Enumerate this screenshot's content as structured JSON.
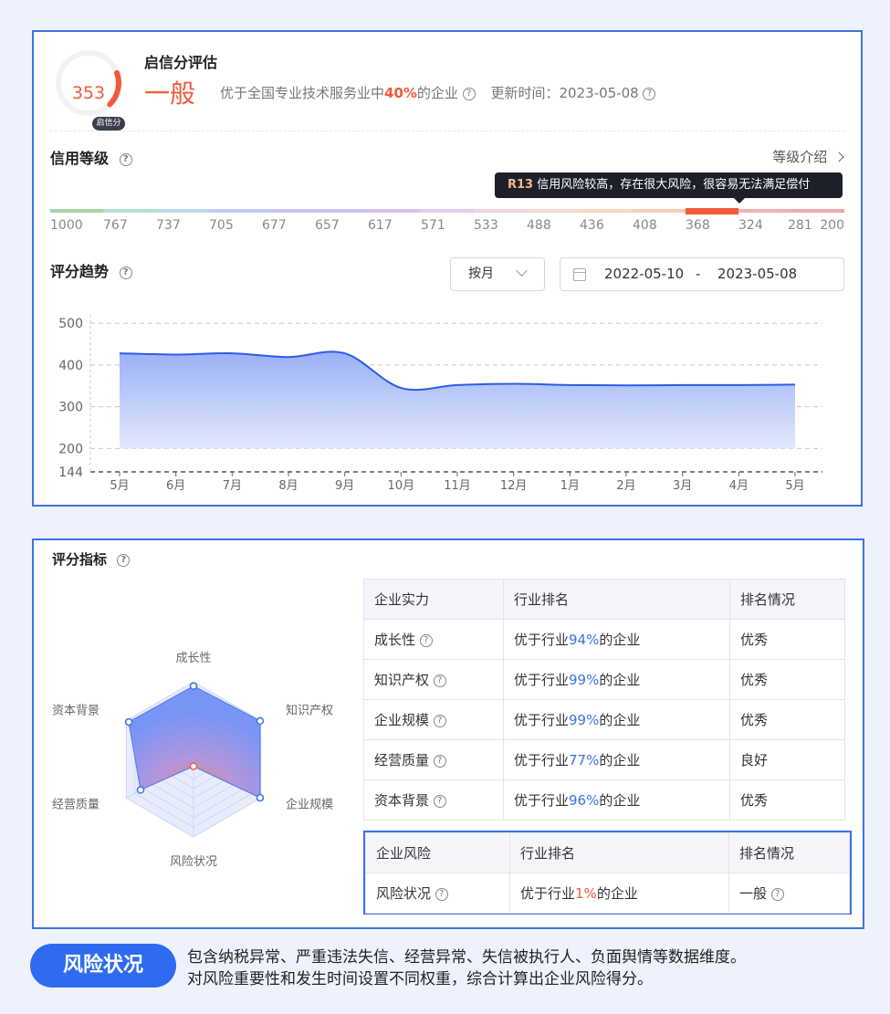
{
  "score": {
    "value": "353",
    "badge": "启信分",
    "title": "启信分评估",
    "grade": "一般",
    "desc_prefix": "优于全国专业技术服务业中",
    "desc_pct": "40%",
    "desc_suffix": "的企业",
    "updated_label": "更新时间：",
    "updated_date": "2023-05-08",
    "gauge_fraction": 0.18
  },
  "credit_level": {
    "title": "信用等级",
    "intro_link": "等级介绍",
    "tooltip_code": "R13",
    "tooltip_text": "信用风险较高，存在很大风险，很容易无法满足偿付",
    "ticks": [
      "1000",
      "767",
      "737",
      "705",
      "677",
      "657",
      "617",
      "571",
      "533",
      "488",
      "436",
      "408",
      "368",
      "324",
      "281",
      "200"
    ],
    "segment_colors": [
      "#a8d4a8",
      "#b2e0cf",
      "#b8dcef",
      "#bfcdf3",
      "#c6c3f3",
      "#cdbff2",
      "#d7c2f0",
      "#e4cbef",
      "#f2d3e4",
      "#f7d9cf",
      "#f8d7c6",
      "#f7cdb8",
      "#f25c3c",
      "#f2b4b0",
      "#f2aaaa"
    ],
    "active_index": 12
  },
  "trend": {
    "title": "评分趋势",
    "period": "按月",
    "date_start": "2022-05-10",
    "date_sep": "-",
    "date_end": "2023-05-08"
  },
  "chart_data": {
    "type": "area",
    "x": [
      "5月",
      "6月",
      "7月",
      "8月",
      "9月",
      "10月",
      "11月",
      "12月",
      "1月",
      "2月",
      "3月",
      "4月",
      "5月"
    ],
    "values": [
      428,
      425,
      428,
      419,
      428,
      345,
      352,
      355,
      352,
      351,
      352,
      352,
      353
    ],
    "yticks": [
      500,
      400,
      300,
      200,
      144
    ],
    "ylim": [
      144,
      520
    ],
    "grid": true,
    "color": "#2f5bea"
  },
  "indicators": {
    "title": "评分指标",
    "radar_labels": [
      "成长性",
      "知识产权",
      "企业规模",
      "风险状况",
      "经营质量",
      "资本背景"
    ],
    "radar_values": [
      94,
      99,
      99,
      1,
      77,
      96
    ],
    "strength_table": {
      "headers": [
        "企业实力",
        "行业排名",
        "排名情况"
      ],
      "rows": [
        {
          "name": "成长性",
          "prefix": "优于行业",
          "pct": "94%",
          "suffix": "的企业",
          "status": "优秀"
        },
        {
          "name": "知识产权",
          "prefix": "优于行业",
          "pct": "99%",
          "suffix": "的企业",
          "status": "优秀"
        },
        {
          "name": "企业规模",
          "prefix": "优于行业",
          "pct": "99%",
          "suffix": "的企业",
          "status": "优秀"
        },
        {
          "name": "经营质量",
          "prefix": "优于行业",
          "pct": "77%",
          "suffix": "的企业",
          "status": "良好"
        },
        {
          "name": "资本背景",
          "prefix": "优于行业",
          "pct": "96%",
          "suffix": "的企业",
          "status": "优秀"
        }
      ]
    },
    "risk_table": {
      "headers": [
        "企业风险",
        "行业排名",
        "排名情况"
      ],
      "row": {
        "name": "风险状况",
        "prefix": "优于行业",
        "pct": "1%",
        "suffix": "的企业",
        "status": "一般"
      }
    }
  },
  "footer": {
    "pill": "风险状况",
    "line1": "包含纳税异常、严重违法失信、经营异常、失信被执行人、负面舆情等数据维度。",
    "line2": "对风险重要性和发生时间设置不同权重，综合计算出企业风险得分。"
  }
}
